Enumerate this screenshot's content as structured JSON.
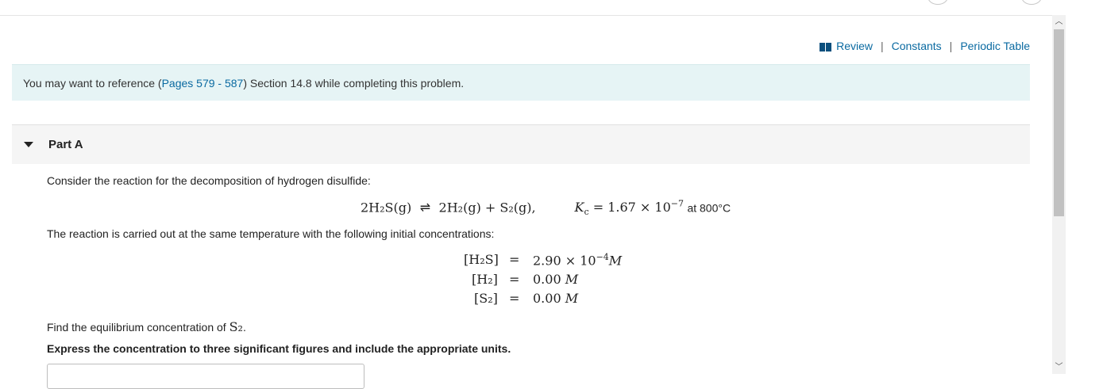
{
  "toolbar": {
    "review": "Review",
    "constants": "Constants",
    "periodic_table": "Periodic Table",
    "separator": "|",
    "review_icon": "book-icon"
  },
  "reference": {
    "prefix": "You may want to reference (",
    "link": "Pages 579 - 587",
    "suffix": ") Section 14.8 while completing this problem."
  },
  "part": {
    "title": "Part A",
    "caret_icon": "caret-down-icon"
  },
  "problem": {
    "intro": "Consider the reaction for the decomposition of hydrogen disulfide:",
    "reaction": {
      "reactant": "2H₂S(g)",
      "arrow": "⇌",
      "products": "2H₂(g) + S₂(g),",
      "kc_label": "K",
      "kc_sub": "c",
      "kc_value": "= 1.67 × 10",
      "kc_exp": "−7",
      "at": "at 800°C"
    },
    "conditions": "The reaction is carried out at the same temperature with the following initial concentrations:",
    "concentrations": [
      {
        "species": "[H₂S]",
        "eq": "=",
        "value": "2.90 × 10",
        "exp": "−4",
        "unit": "M"
      },
      {
        "species": "[H₂]",
        "eq": "=",
        "value": "0.00",
        "exp": "",
        "unit": "M"
      },
      {
        "species": "[S₂]",
        "eq": "=",
        "value": "0.00",
        "exp": "",
        "unit": "M"
      }
    ],
    "find_prefix": "Find the equilibrium concentration of ",
    "find_species": "S₂",
    "find_suffix": ".",
    "instructions": "Express the concentration to three significant figures and include the appropriate units."
  },
  "colors": {
    "link": "#0a6aa1",
    "reference_bg": "#e6f4f5",
    "part_header_bg": "#f5f5f5"
  }
}
